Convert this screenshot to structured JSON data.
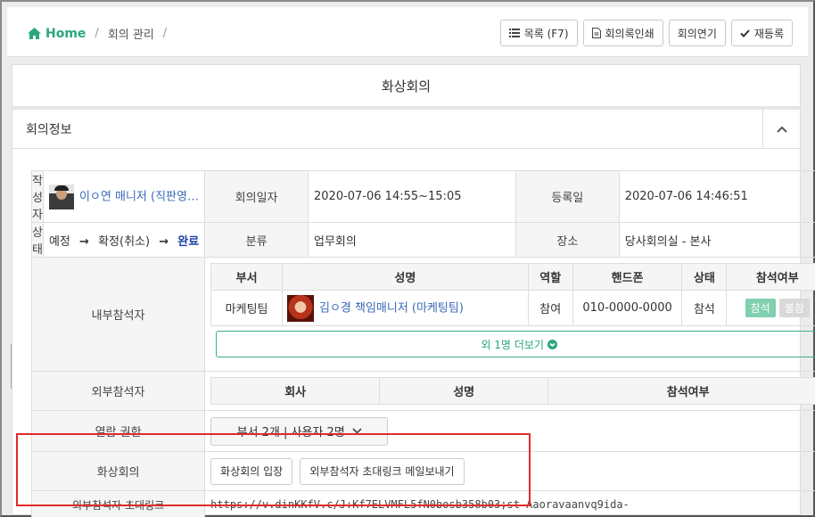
{
  "breadcrumb": {
    "home": "Home",
    "section": "회의 관리"
  },
  "toolbar": {
    "list": "목록 (F7)",
    "print": "회의록인쇄",
    "extend": "회의연기",
    "reregister": "재등록"
  },
  "page_title": "화상회의",
  "section": {
    "title": "회의정보"
  },
  "info": {
    "author_label": "작성자",
    "author_value": "이ㅇ연 매니저 (직판영…",
    "date_label": "회의일자",
    "date_value": "2020-07-06 14:55~15:05",
    "reg_label": "등록일",
    "reg_value": "2020-07-06 14:46:51",
    "status_label": "상태",
    "status_steps": [
      "예정",
      "확정(취소)",
      "완료"
    ],
    "status_arrow": "→",
    "category_label": "분류",
    "category_value": "업무회의",
    "place_label": "장소",
    "place_value": "당사회의실 - 본사"
  },
  "internal": {
    "label": "내부참석자",
    "columns": [
      "부서",
      "성명",
      "역할",
      "핸드폰",
      "상태",
      "참석여부"
    ],
    "rows": [
      {
        "dept": "마케팅팀",
        "name": "김ㅇ경 책임매니저 (마케팅팀)",
        "role": "참여",
        "phone": "010-0000-0000",
        "status": "참석",
        "attend": "참석",
        "absent": "불참"
      }
    ],
    "more": "외 1명 더보기"
  },
  "external": {
    "label": "외부참석자",
    "columns": [
      "회사",
      "성명",
      "참석여부"
    ]
  },
  "permission": {
    "label": "열람 권한",
    "value": "부서 2개 | 사용자 2명"
  },
  "video": {
    "label": "화상회의",
    "enter_button": "화상회의 입장",
    "mail_button": "외부참석자 초대링크 메일보내기"
  },
  "invite": {
    "label": "외부참석자 초대링크",
    "value": "https://v.dinKKfV.c/J:Kf7ELVMFL5fN0bosb358b03;st-Aaoravaanvq9ida-"
  },
  "colors": {
    "accent": "#2aa77c",
    "link": "#3769b8",
    "highlight": "#e02a2a"
  }
}
